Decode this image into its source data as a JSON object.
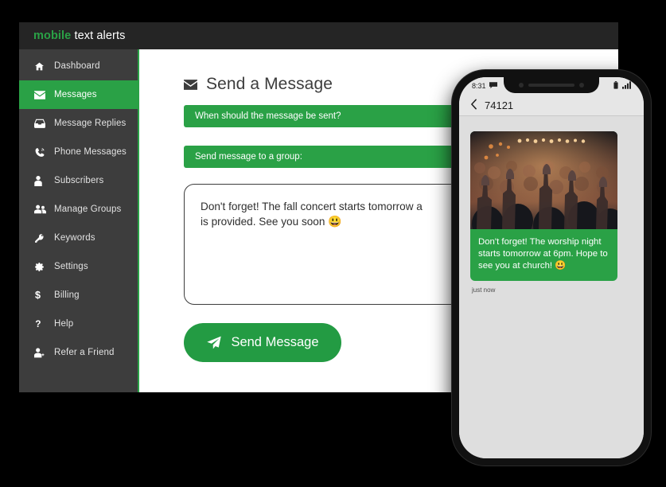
{
  "app": {
    "brand_first": "mobile",
    "brand_rest": " text alerts"
  },
  "sidebar": {
    "items": [
      {
        "label": "Dashboard",
        "icon": "home-icon",
        "active": false
      },
      {
        "label": "Messages",
        "icon": "envelope-icon",
        "active": true
      },
      {
        "label": "Message Replies",
        "icon": "inbox-icon",
        "active": false
      },
      {
        "label": "Phone Messages",
        "icon": "phone-volume-icon",
        "active": false
      },
      {
        "label": "Subscribers",
        "icon": "user-icon",
        "active": false
      },
      {
        "label": "Manage Groups",
        "icon": "users-icon",
        "active": false
      },
      {
        "label": "Keywords",
        "icon": "key-icon",
        "active": false
      },
      {
        "label": "Settings",
        "icon": "gear-icon",
        "active": false
      },
      {
        "label": "Billing",
        "icon": "dollar-icon",
        "active": false
      },
      {
        "label": "Help",
        "icon": "question-icon",
        "active": false
      },
      {
        "label": "Refer a Friend",
        "icon": "user-plus-icon",
        "active": false
      }
    ]
  },
  "main": {
    "title": "Send a Message",
    "title_icon": "envelope-icon",
    "field_when_label": "When should the message be sent?",
    "field_group_label": "Send message to a group:",
    "message_text": "Don't forget! The fall concert starts tomorrow a",
    "message_text_line2": "is provided. See you soon ",
    "message_emoji": "😃",
    "send_button_label": "Send Message",
    "send_button_icon": "paper-plane-icon"
  },
  "phone": {
    "status_time": "8:31",
    "status_left_icon": "message-icon",
    "status_battery_icon": "battery-icon",
    "status_signal_icon": "signal-icon",
    "back_icon": "chevron-left-icon",
    "conversation_title": "74121",
    "message_body": "Don't forget! The worship night starts tomorrow at 6pm. Hope to see you at church! ",
    "message_emoji": "😃",
    "message_time": "just now",
    "attachment_alt": "concert-crowd-photo"
  },
  "colors": {
    "brand_green": "#2aa146",
    "button_green": "#239b43",
    "sidebar_dark": "#3d3d3d",
    "topbar_dark": "#252525",
    "page_bg": "#000000"
  }
}
